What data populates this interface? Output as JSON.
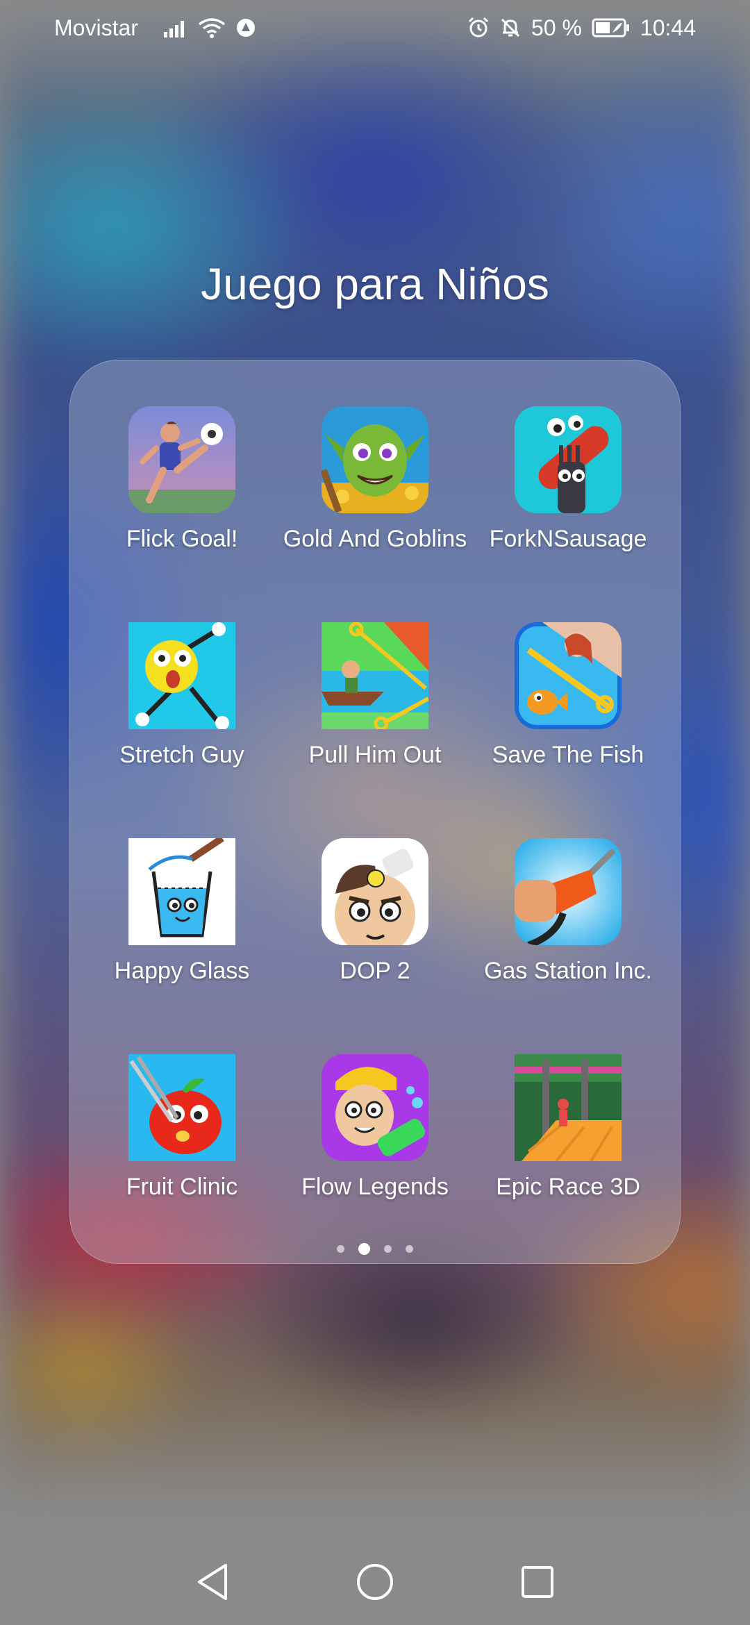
{
  "status_bar": {
    "carrier": "Movistar",
    "battery": "50 %",
    "time": "10:44",
    "icons": [
      "signal-icon",
      "wifi-icon",
      "data-saver-icon",
      "alarm-icon",
      "mute-icon",
      "battery-icon"
    ]
  },
  "folder": {
    "title": "Juego para Niños",
    "apps": [
      {
        "label": "Flick Goal!",
        "icon": "flick-goal-icon"
      },
      {
        "label": "Gold And Goblins",
        "icon": "gold-and-goblins-icon"
      },
      {
        "label": "ForkNSausage",
        "icon": "forknsausage-icon"
      },
      {
        "label": "Stretch Guy",
        "icon": "stretch-guy-icon"
      },
      {
        "label": "Pull Him Out",
        "icon": "pull-him-out-icon"
      },
      {
        "label": "Save The Fish",
        "icon": "save-the-fish-icon"
      },
      {
        "label": "Happy Glass",
        "icon": "happy-glass-icon"
      },
      {
        "label": "DOP 2",
        "icon": "dop-2-icon"
      },
      {
        "label": "Gas Station Inc.",
        "icon": "gas-station-icon"
      },
      {
        "label": "Fruit Clinic",
        "icon": "fruit-clinic-icon"
      },
      {
        "label": "Flow Legends",
        "icon": "flow-legends-icon"
      },
      {
        "label": "Epic Race 3D",
        "icon": "epic-race-3d-icon"
      }
    ],
    "page_indicator": {
      "count": 4,
      "active": 2
    }
  },
  "nav_bar": {
    "buttons": [
      "back-button",
      "home-button",
      "recents-button"
    ]
  }
}
